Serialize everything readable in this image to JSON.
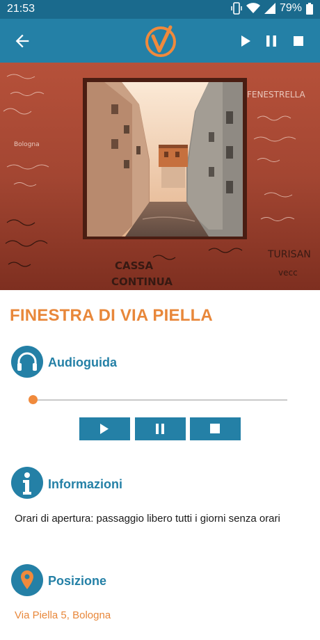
{
  "statusbar": {
    "time": "21:53",
    "battery": "79%"
  },
  "appbar": {
    "back_icon": "arrow-left-icon",
    "logo_icon": "v-check-logo",
    "play": "play-icon",
    "pause": "pause-icon",
    "stop": "stop-icon"
  },
  "poi": {
    "title": "FINESTRA DI VIA PIELLA"
  },
  "audio": {
    "label": "Audioguida",
    "progress": 0
  },
  "info": {
    "label": "Informazioni",
    "text": "Orari di apertura: passaggio libero tutti i giorni senza orari"
  },
  "position": {
    "label": "Posizione",
    "address": "Via Piella 5, Bologna"
  },
  "colors": {
    "primary": "#2480a6",
    "statusbar": "#1a6a8d",
    "accent": "#e8873a"
  },
  "hero_graffiti": [
    "FENESTRELLA",
    "CASSA CONTINUA",
    "TURISAN",
    "Bologna",
    "vecc"
  ]
}
